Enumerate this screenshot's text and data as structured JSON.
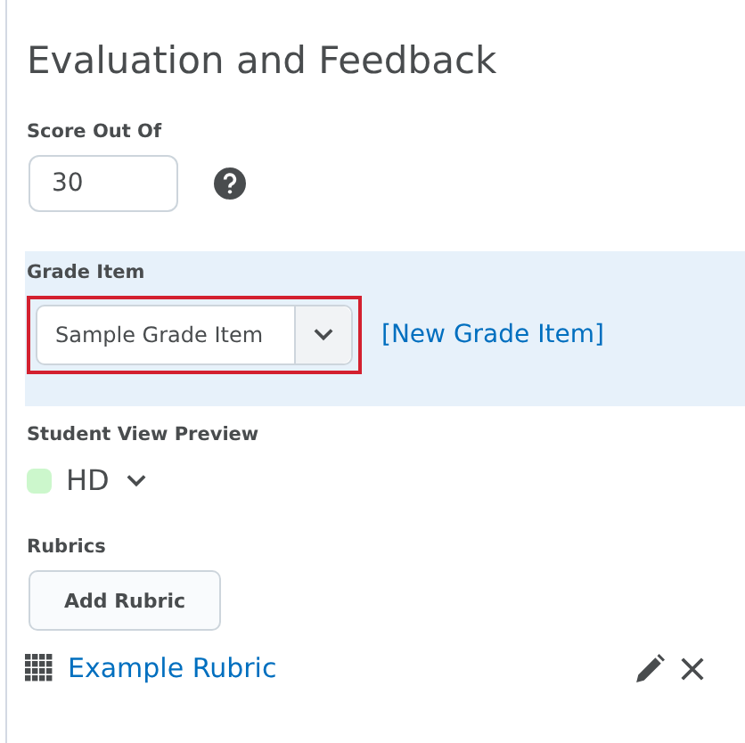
{
  "title": "Evaluation and Feedback",
  "score": {
    "label": "Score Out Of",
    "value": "30"
  },
  "grade_item": {
    "label": "Grade Item",
    "value": "Sample Grade Item",
    "highlighted": true,
    "link": "[New Grade Item]"
  },
  "preview": {
    "label": "Student View Preview",
    "level_name": "HD",
    "color": "#ccf7cc"
  },
  "rubrics": {
    "label": "Rubrics",
    "button": "Add Rubric",
    "items": [
      {
        "name": "Example Rubric"
      }
    ]
  }
}
